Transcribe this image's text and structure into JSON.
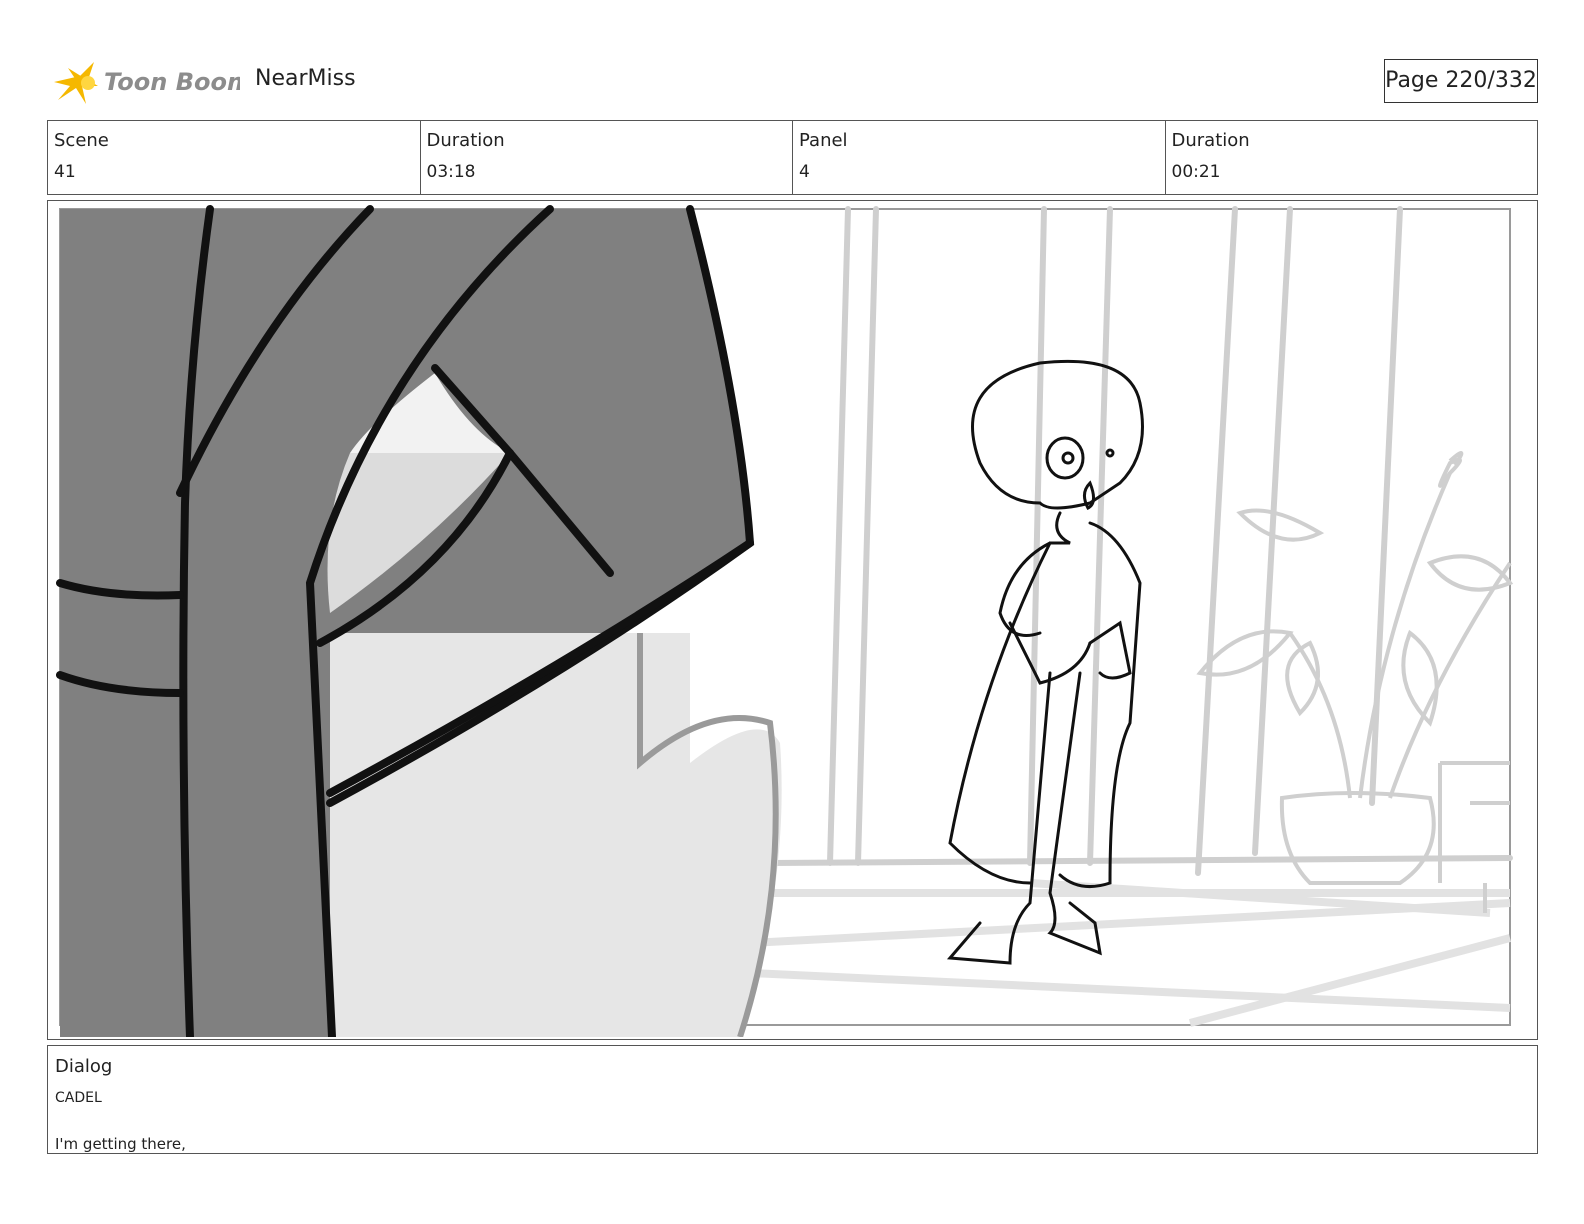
{
  "header": {
    "logo_text": "Toon Boom",
    "project_title": "NearMiss",
    "page_indicator": "Page 220/332"
  },
  "info": {
    "scene_label": "Scene",
    "scene_value": "41",
    "scene_duration_label": "Duration",
    "scene_duration_value": "03:18",
    "panel_label": "Panel",
    "panel_value": "4",
    "panel_duration_label": "Duration",
    "panel_duration_value": "00:21"
  },
  "dialog": {
    "label": "Dialog",
    "speaker": "CADEL",
    "line": "I'm getting there,"
  }
}
